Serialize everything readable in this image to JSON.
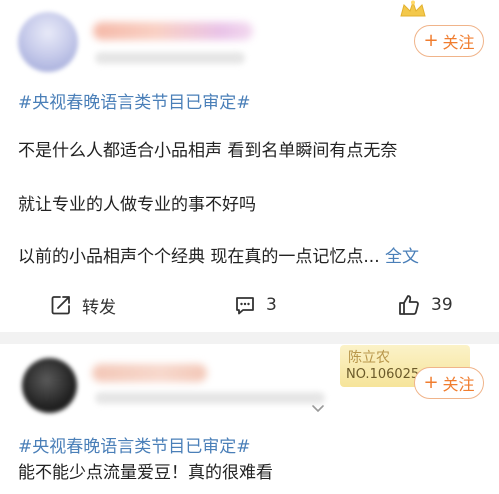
{
  "posts": [
    {
      "follow_label": "关注",
      "hashtag": "#央视春晚语言类节目已审定#",
      "lines": [
        "不是什么人都适合小品相声 看到名单瞬间有点无奈",
        "就让专业的人做专业的事不好吗",
        "以前的小品相声个个经典 现在真的一点记忆点..."
      ],
      "more_label": "全文",
      "actions": {
        "repost_label": "转发",
        "comment_count": "3",
        "like_count": "39"
      }
    },
    {
      "follow_label": "关注",
      "badge": {
        "name": "陈立农",
        "number": "NO.106025"
      },
      "hashtag": "#央视春晚语言类节目已审定#",
      "text": "能不能少点流量爱豆！真的很难看"
    }
  ],
  "icons": {
    "follow": "plus-icon",
    "repost": "share-icon",
    "comment": "comment-icon",
    "like": "thumbs-up-icon",
    "crown": "crown-icon",
    "dropdown": "chevron-down-icon"
  },
  "colors": {
    "accent_orange": "#f07d2f",
    "link_blue": "#4a7fb8",
    "text": "#222222",
    "divider": "#f2f2f2",
    "badge_gold": "#f6e49a"
  }
}
